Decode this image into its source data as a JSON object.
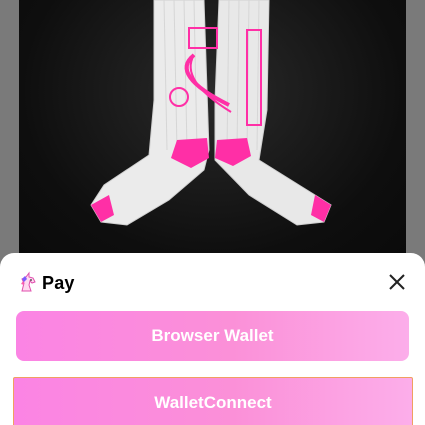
{
  "sheet": {
    "title": "Pay",
    "logo_icon": "unicorn-icon",
    "close_icon": "close-icon"
  },
  "buttons": {
    "browser_wallet": "Browser Wallet",
    "walletconnect": "WalletConnect"
  },
  "product": {
    "image_icon": "socks-image"
  },
  "colors": {
    "button_start": "#fb84e4",
    "button_end": "#fcaeea",
    "accent_pink": "#ff2fa6",
    "sheet_bg": "#ffffff",
    "backdrop": "#7a7a7a"
  }
}
